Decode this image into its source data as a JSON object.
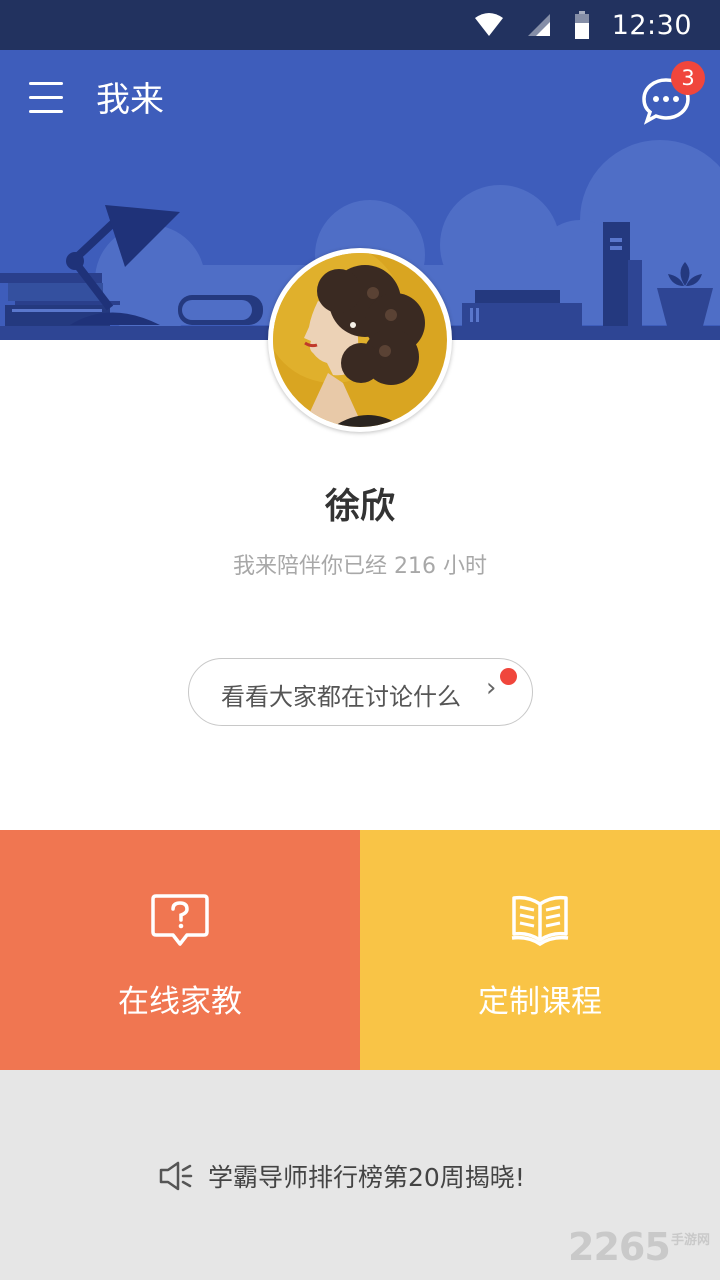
{
  "status_bar": {
    "time": "12:30"
  },
  "app_bar": {
    "title": "我来",
    "message_badge": "3"
  },
  "profile": {
    "name": "徐欣",
    "companion_text": "我来陪伴你已经 216 小时"
  },
  "discuss": {
    "label": "看看大家都在讨论什么",
    "chevron": "›"
  },
  "tiles": [
    {
      "label": "在线家教",
      "icon": "question-bubble-icon",
      "color": "#f07651"
    },
    {
      "label": "定制课程",
      "icon": "open-book-icon",
      "color": "#f9c446"
    }
  ],
  "notice": {
    "text": "学霸导师排行榜第20周揭晓!",
    "icon": "speaker-icon"
  },
  "watermark": {
    "number": "2265",
    "sub": "手游网"
  },
  "colors": {
    "banner": "#3e5dbb",
    "status_bar": "#22325f",
    "badge": "#f0463c",
    "footer": "#e6e6e6"
  }
}
